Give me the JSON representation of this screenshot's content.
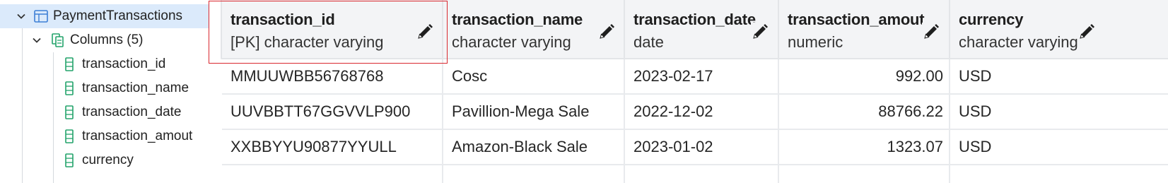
{
  "tree": {
    "table_name": "PaymentTransactions",
    "columns_label": "Columns (5)",
    "columns": [
      "transaction_id",
      "transaction_name",
      "transaction_date",
      "transaction_amout",
      "currency"
    ]
  },
  "grid": {
    "headers": [
      {
        "name": "transaction_id",
        "type": "[PK] character varying"
      },
      {
        "name": "transaction_name",
        "type": "character varying"
      },
      {
        "name": "transaction_date",
        "type": "date"
      },
      {
        "name": "transaction_amout",
        "type": "numeric"
      },
      {
        "name": "currency",
        "type": "character varying"
      }
    ],
    "rows": [
      [
        "MMUUWBB56768768",
        "Cosc",
        "2023-02-17",
        "992.00",
        "USD"
      ],
      [
        "UUVBBTT67GGVVLP900",
        "Pavillion-Mega Sale",
        "2022-12-02",
        "88766.22",
        "USD"
      ],
      [
        "XXBBYYU90877YYULL",
        "Amazon-Black Sale",
        "2023-01-02",
        "1323.07",
        "USD"
      ]
    ]
  },
  "colors": {
    "selection_border": "#d9282f",
    "tree_selected_bg": "#dbeafb",
    "tree_icon_blue": "#3d7fd6",
    "tree_icon_green": "#23a36b"
  },
  "icons": {
    "table": "table-icon",
    "columns": "columns-icon",
    "column": "column-icon",
    "edit": "pencil-icon",
    "expand": "chevron-down-icon"
  }
}
